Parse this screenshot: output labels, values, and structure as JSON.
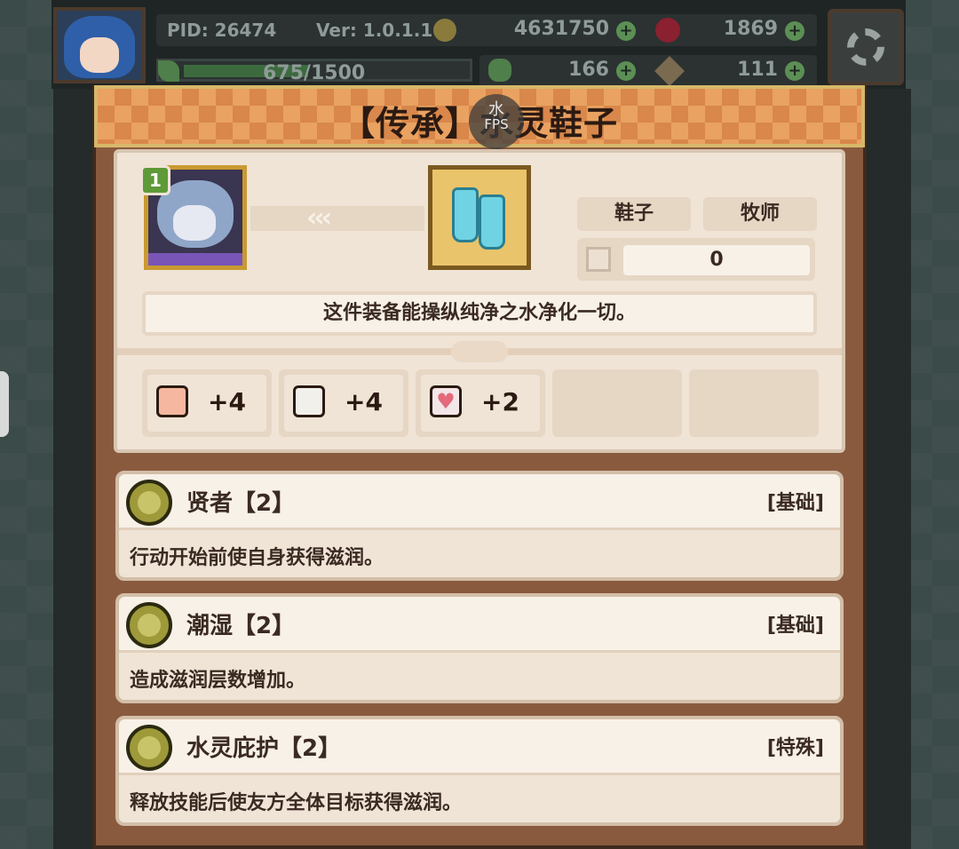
{
  "hud": {
    "pid": "PID: 26474",
    "version": "Ver: 1.0.1.1",
    "gold": "4631750",
    "gems": "1869",
    "energy": "675/1500",
    "clover": "166",
    "pickaxe": "111"
  },
  "dialog": {
    "title": "【传承】水灵鞋子",
    "fps_label": "FPS",
    "fps_value": "水",
    "hero_level": "1",
    "arrows": "‹‹‹",
    "tags": [
      "鞋子",
      "牧师"
    ],
    "count": "0",
    "description": "这件装备能操纵纯净之水净化一切。",
    "stats": [
      {
        "icon": "fist-icon",
        "value": "+4"
      },
      {
        "icon": "book-icon",
        "value": "+4"
      },
      {
        "icon": "heart-icon",
        "value": "+2"
      }
    ],
    "skills": [
      {
        "name": "贤者【2】",
        "type": "[基础]",
        "desc": "行动开始前使自身获得滋润。"
      },
      {
        "name": "潮湿【2】",
        "type": "[基础]",
        "desc": "造成滋润层数增加。"
      },
      {
        "name": "水灵庇护【2】",
        "type": "[特殊]",
        "desc": "释放技能后使友方全体目标获得滋润。"
      }
    ]
  },
  "colors": {
    "title_bar": "#e9a261",
    "panel": "#f0e4d6",
    "frame": "#8a5a3e",
    "text": "#3a2a22"
  }
}
